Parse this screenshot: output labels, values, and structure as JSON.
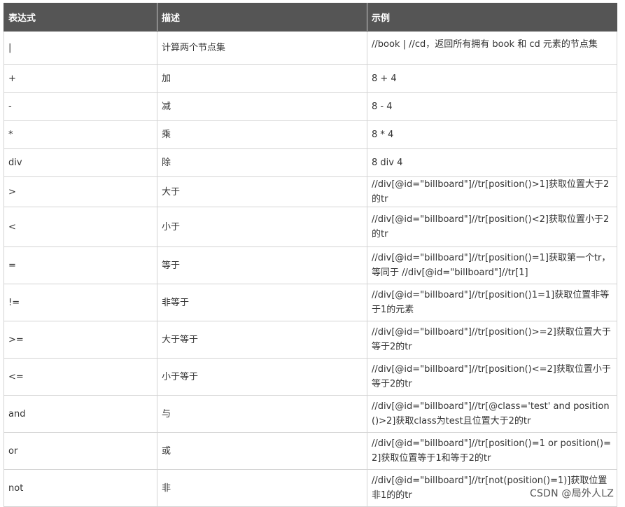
{
  "table": {
    "headers": [
      "表达式",
      "描述",
      "示例"
    ],
    "rows": [
      {
        "expr": "|",
        "desc": "计算两个节点集",
        "example": "//book | //cd，返回所有拥有 book 和 cd 元素的节点集"
      },
      {
        "expr": "+",
        "desc": "加",
        "example": "8 + 4"
      },
      {
        "expr": "-",
        "desc": "减",
        "example": "8 - 4"
      },
      {
        "expr": "*",
        "desc": "乘",
        "example": "8 * 4"
      },
      {
        "expr": "div",
        "desc": "除",
        "example": "8 div 4"
      },
      {
        "expr": ">",
        "desc": "大于",
        "example": "//div[@id=\"billboard\"]//tr[position()>1]获取位置大于2的tr"
      },
      {
        "expr": "<",
        "desc": "小于",
        "example": "//div[@id=\"billboard\"]//tr[position()<2]获取位置小于2的tr"
      },
      {
        "expr": "=",
        "desc": "等于",
        "example": "//div[@id=\"billboard\"]//tr[position()=1]获取第一个tr，等同于 //div[@id=\"billboard\"]//tr[1]"
      },
      {
        "expr": "!=",
        "desc": "非等于",
        "example": "//div[@id=\"billboard\"]//tr[position()1=1]获取位置非等于1的元素"
      },
      {
        "expr": ">=",
        "desc": "大于等于",
        "example": "//div[@id=\"billboard\"]//tr[position()>=2]获取位置大于等于2的tr"
      },
      {
        "expr": "<=",
        "desc": "小于等于",
        "example": "//div[@id=\"billboard\"]//tr[position()<=2]获取位置小于等于2的tr"
      },
      {
        "expr": "and",
        "desc": "与",
        "example": "//div[@id=\"billboard\"]//tr[@class='test' and position()>2]获取class为test且位置大于2的tr"
      },
      {
        "expr": "or",
        "desc": "或",
        "example": "//div[@id=\"billboard\"]//tr[position()=1 or position()=2]获取位置等于1和等于2的tr"
      },
      {
        "expr": "not",
        "desc": "非",
        "example": "//div[@id=\"billboard\"]//tr[not(position()=1)]获取位置非1的的tr"
      }
    ]
  },
  "watermark": "CSDN @局外人LZ"
}
